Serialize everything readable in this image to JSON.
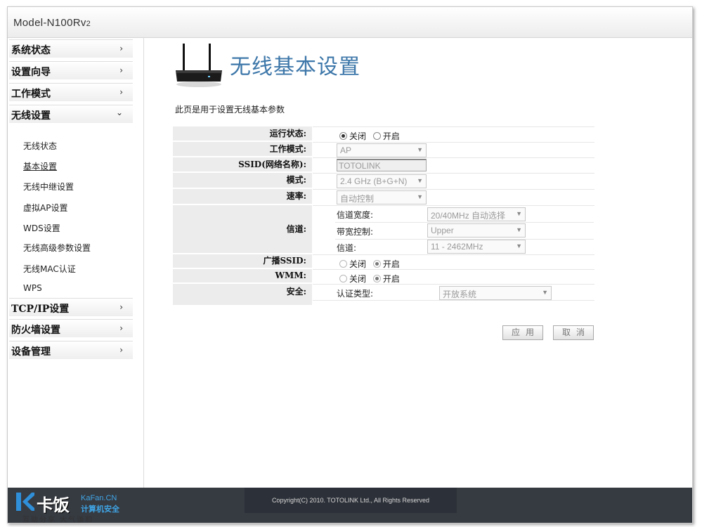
{
  "header": {
    "model_main": "Model-N100Rv",
    "model_sub": "2"
  },
  "sidebar": {
    "items": [
      {
        "label": "系统状态",
        "arrow": "›"
      },
      {
        "label": "设置向导",
        "arrow": "›"
      },
      {
        "label": "工作模式",
        "arrow": "›"
      },
      {
        "label": "无线设置",
        "arrow": "⌄"
      },
      {
        "label": "TCP/IP设置",
        "arrow": "›"
      },
      {
        "label": "防火墙设置",
        "arrow": "›"
      },
      {
        "label": "设备管理",
        "arrow": "›"
      }
    ],
    "subitems": [
      "无线状态",
      "基本设置",
      "无线中继设置",
      "虚拟AP设置",
      "WDS设置",
      "无线高级参数设置",
      "无线MAC认证",
      "WPS"
    ],
    "active_subitem": "基本设置"
  },
  "page": {
    "title": "无线基本设置",
    "description": "此页是用于设置无线基本参数"
  },
  "form": {
    "run_status": {
      "label": "运行状态:",
      "off": "关闭",
      "on": "开启",
      "selected": "关闭"
    },
    "work_mode": {
      "label": "工作模式:",
      "value": "AP"
    },
    "ssid": {
      "label": "SSID(网络名称):",
      "value": "TOTOLINK"
    },
    "mode": {
      "label": "模式:",
      "value": "2.4 GHz (B+G+N)"
    },
    "rate": {
      "label": "速率:",
      "value": "自动控制"
    },
    "channel": {
      "label": "信道:",
      "width_label": "信道宽度:",
      "width_value": "20/40MHz 自动选择",
      "band_label": "带宽控制:",
      "band_value": "Upper",
      "channel_label": "信道:",
      "channel_value": "11 - 2462MHz"
    },
    "broadcast_ssid": {
      "label": "广播SSID:",
      "off": "关闭",
      "on": "开启",
      "selected": "开启"
    },
    "wmm": {
      "label": "WMM:",
      "off": "关闭",
      "on": "开启",
      "selected": "开启"
    },
    "security": {
      "label": "安全:",
      "auth_label": "认证类型:",
      "auth_value": "开放系统"
    }
  },
  "buttons": {
    "apply": "应用",
    "cancel": "取消"
  },
  "footer": {
    "copyright": "Copyright(C) 2010. TOTOLINK Ltd.,   All Rights Reserved"
  },
  "watermark": {
    "brand": "卡饭",
    "site": "KaFan.CN",
    "sub": "计算机安全",
    "slogan": "互助分享  大气谦和"
  },
  "icons": {
    "router": "router-icon",
    "select_caret": "caret-down-icon"
  }
}
